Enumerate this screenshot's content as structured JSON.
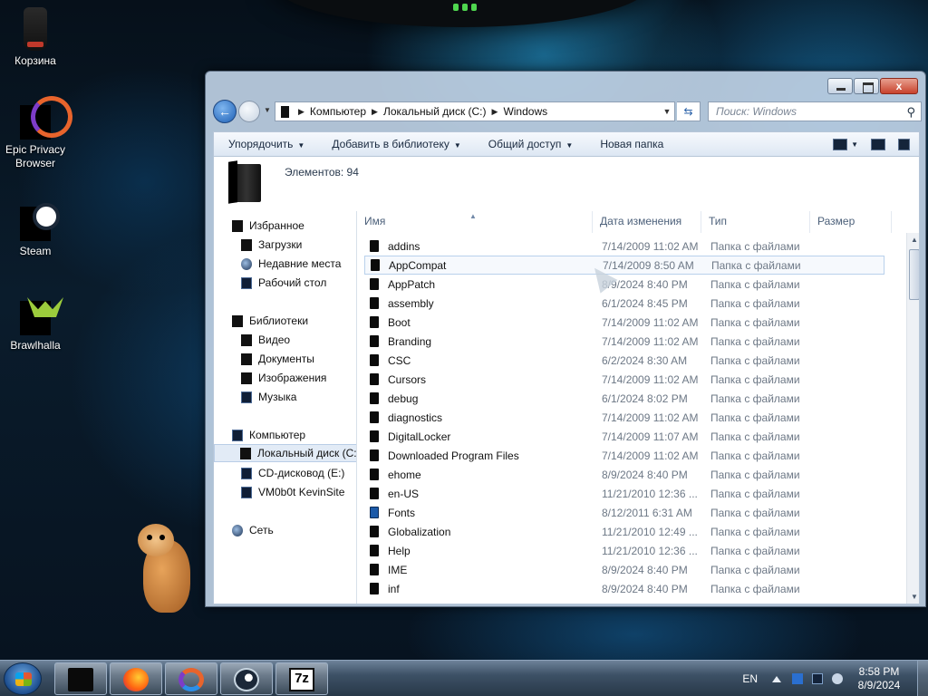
{
  "desktop": {
    "icons": [
      {
        "label": "Корзина"
      },
      {
        "label": "Epic Privacy Browser"
      },
      {
        "label": "Steam"
      },
      {
        "label": "Brawlhalla"
      }
    ]
  },
  "window": {
    "caption": {
      "close_glyph": "x"
    },
    "address": {
      "segments": [
        "Компьютер",
        "Локальный диск (C:)",
        "Windows"
      ],
      "refresh_glyph": "⇆"
    },
    "search": {
      "placeholder": "Поиск: Windows"
    },
    "commands": [
      {
        "label": "Упорядочить",
        "dropdown": true
      },
      {
        "label": "Добавить в библиотеку",
        "dropdown": true
      },
      {
        "label": "Общий доступ",
        "dropdown": true
      },
      {
        "label": "Новая папка",
        "dropdown": false
      }
    ],
    "details": {
      "count_text": "Элементов: 94"
    },
    "nav_pane": {
      "favorites": {
        "label": "Избранное",
        "items": [
          "Загрузки",
          "Недавние места",
          "Рабочий стол"
        ]
      },
      "libraries": {
        "label": "Библиотеки",
        "items": [
          "Видео",
          "Документы",
          "Изображения",
          "Музыка"
        ]
      },
      "computer": {
        "label": "Компьютер",
        "items": [
          "Локальный диск (C:)",
          "CD-дисковод (E:)",
          "VM0b0t KevinSite"
        ],
        "selected": "Локальный диск (C:)"
      },
      "network": {
        "label": "Сеть"
      }
    },
    "columns": [
      "Имя",
      "Дата изменения",
      "Тип",
      "Размер"
    ],
    "files": [
      {
        "name": "addins",
        "date": "7/14/2009 11:02 AM",
        "type": "Папка с файлами"
      },
      {
        "name": "AppCompat",
        "date": "7/14/2009 8:50 AM",
        "type": "Папка с файлами"
      },
      {
        "name": "AppPatch",
        "date": "8/9/2024 8:40 PM",
        "type": "Папка с файлами"
      },
      {
        "name": "assembly",
        "date": "6/1/2024 8:45 PM",
        "type": "Папка с файлами"
      },
      {
        "name": "Boot",
        "date": "7/14/2009 11:02 AM",
        "type": "Папка с файлами"
      },
      {
        "name": "Branding",
        "date": "7/14/2009 11:02 AM",
        "type": "Папка с файлами"
      },
      {
        "name": "CSC",
        "date": "6/2/2024 8:30 AM",
        "type": "Папка с файлами"
      },
      {
        "name": "Cursors",
        "date": "7/14/2009 11:02 AM",
        "type": "Папка с файлами"
      },
      {
        "name": "debug",
        "date": "6/1/2024 8:02 PM",
        "type": "Папка с файлами"
      },
      {
        "name": "diagnostics",
        "date": "7/14/2009 11:02 AM",
        "type": "Папка с файлами"
      },
      {
        "name": "DigitalLocker",
        "date": "7/14/2009 11:07 AM",
        "type": "Папка с файлами"
      },
      {
        "name": "Downloaded Program Files",
        "date": "7/14/2009 11:02 AM",
        "type": "Папка с файлами"
      },
      {
        "name": "ehome",
        "date": "8/9/2024 8:40 PM",
        "type": "Папка с файлами"
      },
      {
        "name": "en-US",
        "date": "11/21/2010 12:36 ...",
        "type": "Папка с файлами"
      },
      {
        "name": "Fonts",
        "date": "8/12/2011 6:31 AM",
        "type": "Папка с файлами"
      },
      {
        "name": "Globalization",
        "date": "11/21/2010 12:49 ...",
        "type": "Папка с файлами"
      },
      {
        "name": "Help",
        "date": "11/21/2010 12:36 ...",
        "type": "Папка с файлами"
      },
      {
        "name": "IME",
        "date": "8/9/2024 8:40 PM",
        "type": "Папка с файлами"
      },
      {
        "name": "inf",
        "date": "8/9/2024 8:40 PM",
        "type": "Папка с файлами"
      }
    ],
    "hovered_file": "AppCompat"
  },
  "taskbar": {
    "pinned": [
      {
        "name": "explorer",
        "glyph": ""
      },
      {
        "name": "firefox",
        "glyph": ""
      },
      {
        "name": "epic-privacy-browser",
        "glyph": ""
      },
      {
        "name": "steam",
        "glyph": ""
      },
      {
        "name": "7zip",
        "glyph": "7z"
      }
    ],
    "tray": {
      "lang": "EN",
      "time": "8:58 PM",
      "date": "8/9/2024"
    }
  }
}
